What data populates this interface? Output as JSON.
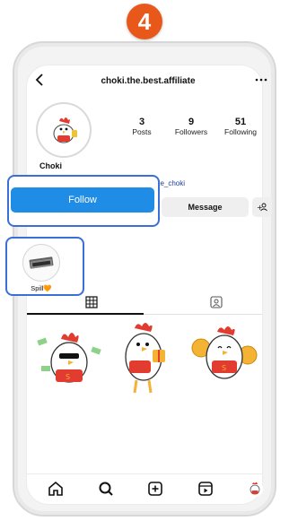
{
  "step": {
    "number": "4"
  },
  "header": {
    "back_icon": "back-arrow-icon",
    "username_title": "choki.the.best.affiliate",
    "more_icon": "more-icon"
  },
  "profile": {
    "name": "Choki",
    "username_link": "ee_choki",
    "stats": [
      {
        "value": "3",
        "label": "Posts"
      },
      {
        "value": "9",
        "label": "Followers"
      },
      {
        "value": "51",
        "label": "Following"
      }
    ]
  },
  "actions": {
    "follow_label": "Follow",
    "message_label": "Message",
    "add_user_icon": "add-user-icon"
  },
  "highlight": {
    "label": "Spill🧡"
  },
  "tabs": [
    {
      "icon": "grid-icon",
      "active": true
    },
    {
      "icon": "tagged-icon",
      "active": false
    }
  ],
  "bottom_nav": [
    "home-icon",
    "search-icon",
    "create-icon",
    "reels-icon",
    "profile-avatar"
  ],
  "colors": {
    "follow_blue": "#1f8ce6",
    "highlight_border": "#3a6fd8",
    "step_badge": "#e8581b"
  }
}
